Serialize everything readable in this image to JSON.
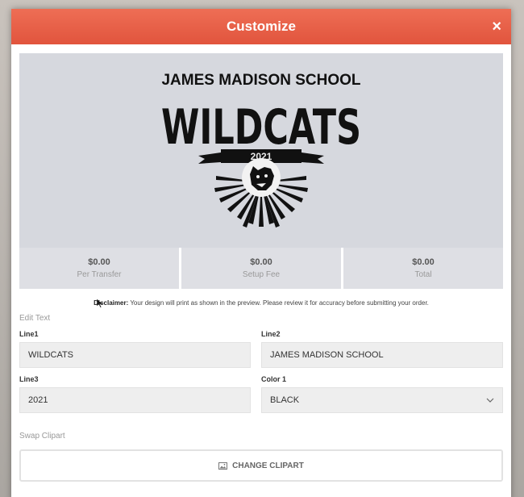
{
  "modal": {
    "title": "Customize",
    "close_glyph": "×"
  },
  "logo": {
    "line2": "JAMES MADISON SCHOOL",
    "line1": "WILDCATS",
    "line3": "2021",
    "mascot_icon": "wildcat-head-icon"
  },
  "stats": [
    {
      "value": "$0.00",
      "label": "Per Transfer"
    },
    {
      "value": "$0.00",
      "label": "Setup Fee"
    },
    {
      "value": "$0.00",
      "label": "Total"
    }
  ],
  "disclaimer": {
    "title": "Disclaimer:",
    "text": " Your design will print as shown in the preview. Please review it for accuracy before submitting your order."
  },
  "edit_text": {
    "heading": "Edit Text",
    "line1": {
      "label": "Line1",
      "value": "WILDCATS"
    },
    "line2": {
      "label": "Line2",
      "value": "JAMES MADISON SCHOOL"
    },
    "line3": {
      "label": "Line3",
      "value": "2021"
    },
    "color1": {
      "label": "Color 1",
      "value": "BLACK"
    }
  },
  "clipart": {
    "heading": "Swap Clipart",
    "button_label": "CHANGE CLIPART",
    "button_icon": "image-icon"
  },
  "colors": {
    "header": "#e65a42",
    "accent_text": "#ffffff"
  }
}
